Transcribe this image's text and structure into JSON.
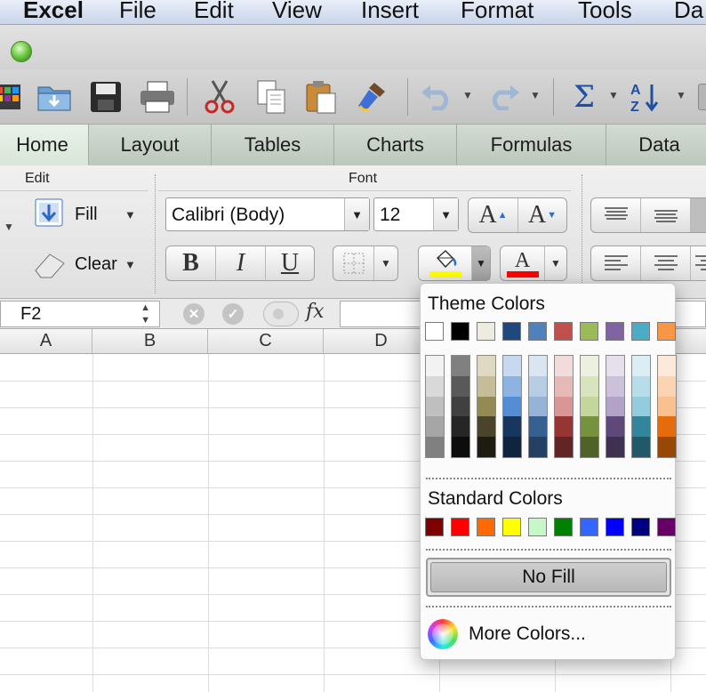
{
  "menubar": {
    "app": "Excel",
    "items": [
      "File",
      "Edit",
      "View",
      "Insert",
      "Format",
      "Tools",
      "Da"
    ]
  },
  "ribbon_tabs": [
    "Home",
    "Layout",
    "Tables",
    "Charts",
    "Formulas",
    "Data"
  ],
  "ribbon": {
    "edit_group_label": "Edit",
    "font_group_label": "Font",
    "fill_label": "Fill",
    "clear_label": "Clear",
    "font_name": "Calibri (Body)",
    "font_size": "12",
    "grow_font_label": "A",
    "shrink_font_label": "A",
    "bold_label": "B",
    "italic_label": "I",
    "underline_label": "U",
    "font_color_label": "A",
    "fill_color": "#ffff00",
    "font_color": "#ff0000"
  },
  "formula_bar": {
    "cell_ref": "F2",
    "fx_label": "fx"
  },
  "grid": {
    "columns": [
      "A",
      "B",
      "C",
      "D"
    ]
  },
  "color_popup": {
    "theme_title": "Theme Colors",
    "theme_row": [
      "#ffffff",
      "#000000",
      "#eeece1",
      "#1f497d",
      "#4f81bd",
      "#c0504d",
      "#9bbb59",
      "#8064a2",
      "#4bacc6",
      "#f79646"
    ],
    "theme_shades": [
      [
        "#f2f2f2",
        "#d9d9d9",
        "#bfbfbf",
        "#a6a6a6",
        "#808080"
      ],
      [
        "#808080",
        "#595959",
        "#404040",
        "#262626",
        "#0d0d0d"
      ],
      [
        "#ddd9c3",
        "#c4bd97",
        "#948a54",
        "#4a452a",
        "#1e1c11"
      ],
      [
        "#c6d9f1",
        "#8db3e2",
        "#548dd4",
        "#17375e",
        "#0f243e"
      ],
      [
        "#dbe5f1",
        "#b8cce4",
        "#95b3d7",
        "#366092",
        "#244062"
      ],
      [
        "#f2dcdb",
        "#e6b9b8",
        "#da9694",
        "#963634",
        "#632523"
      ],
      [
        "#ebf1de",
        "#d7e4bd",
        "#c3d69b",
        "#76923c",
        "#4f6228"
      ],
      [
        "#e5e0ec",
        "#ccc1da",
        "#b2a2c7",
        "#5f497a",
        "#3f3151"
      ],
      [
        "#dbeef4",
        "#b7dee8",
        "#93cddd",
        "#31869b",
        "#215968"
      ],
      [
        "#fde9d9",
        "#fbd4b4",
        "#fac08f",
        "#e46c0a",
        "#974806"
      ]
    ],
    "standard_title": "Standard Colors",
    "standard_row": [
      "#7f0000",
      "#ff0000",
      "#ff6a00",
      "#ffff00",
      "#c6f7c6",
      "#008000",
      "#3366ff",
      "#0000ff",
      "#000080",
      "#660066"
    ],
    "no_fill_label": "No Fill",
    "more_colors_label": "More Colors..."
  }
}
